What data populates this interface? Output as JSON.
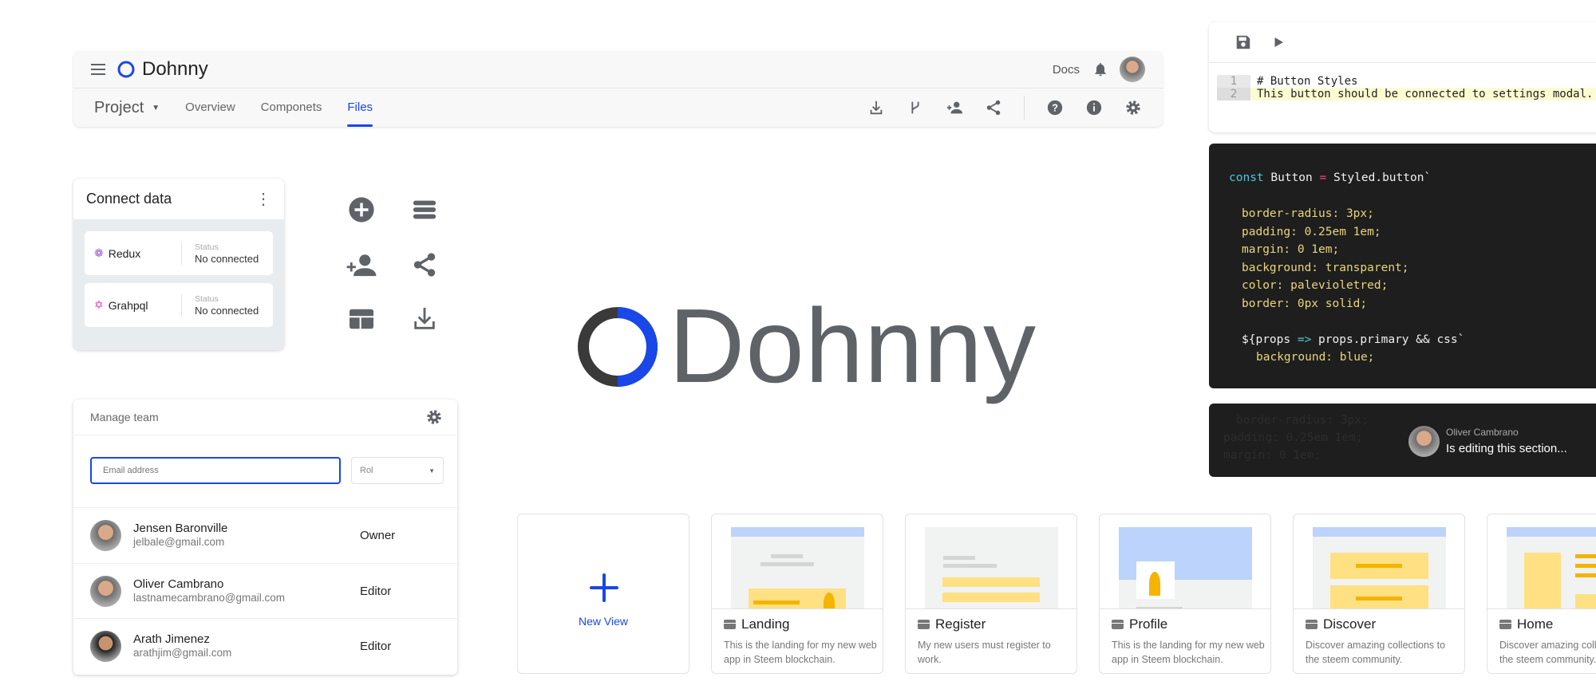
{
  "header": {
    "brand": "Dohnny",
    "docs": "Docs",
    "project": "Project",
    "tabs": [
      "Overview",
      "Componets",
      "Files"
    ],
    "active_tab": "Files"
  },
  "editor": {
    "lines": [
      {
        "n": "1",
        "text": "# Button Styles"
      },
      {
        "n": "2",
        "text": "This button should be connected to settings modal."
      }
    ]
  },
  "code": {
    "l1a": "const",
    "l1b": " Button ",
    "l1c": "=",
    "l1d": " Styled.button`",
    "props": [
      "border-radius: 3px;",
      "padding: 0.25em 1em;",
      "margin: 0 1em;",
      "background: transparent;",
      "color: palevioletred;",
      "border: 0px solid;"
    ],
    "l8a": "${props ",
    "l8b": "=>",
    "l8c": " props.primary && css`",
    "l9": "background: blue;"
  },
  "editing": {
    "ghost": [
      "border-radius: 3px;",
      "padding: 0.25em 1em;",
      "margin: 0 1em;"
    ],
    "user": "Oliver Cambrano",
    "status": "Is editing this section..."
  },
  "connect": {
    "title": "Connect data",
    "sources": [
      {
        "name": "Redux",
        "status_label": "Status",
        "status": "No connected",
        "color": "#9b59d8"
      },
      {
        "name": "Grahpql",
        "status_label": "Status",
        "status": "No connected",
        "color": "#e535ab"
      }
    ]
  },
  "logo": {
    "text": "Dohnny"
  },
  "team": {
    "title": "Manage team",
    "email_placeholder": "Email address",
    "role_placeholder": "Rol",
    "members": [
      {
        "name": "Jensen Baronville",
        "email": "jelbale@gmail.com",
        "role": "Owner"
      },
      {
        "name": "Oliver Cambrano",
        "email": "lastnamecambrano@gmail.com",
        "role": "Editor"
      },
      {
        "name": "Arath Jimenez",
        "email": "arathjim@gmail.com",
        "role": "Editor"
      }
    ]
  },
  "views": {
    "new_label": "New View",
    "items": [
      {
        "title": "Landing",
        "desc": "This is the landing for my new web app in Steem blockchain."
      },
      {
        "title": "Register",
        "desc": "My new users must register to work."
      },
      {
        "title": "Profile",
        "desc": "This is the landing for my new web app in Steem blockchain."
      },
      {
        "title": "Discover",
        "desc": "Discover amazing collections to the steem community."
      },
      {
        "title": "Home",
        "desc": "Discover amazing collections to the steem community."
      }
    ]
  },
  "colors": {
    "accent": "#1a47e8",
    "icon": "#5f6368",
    "code_bg": "#1e1e1e"
  }
}
